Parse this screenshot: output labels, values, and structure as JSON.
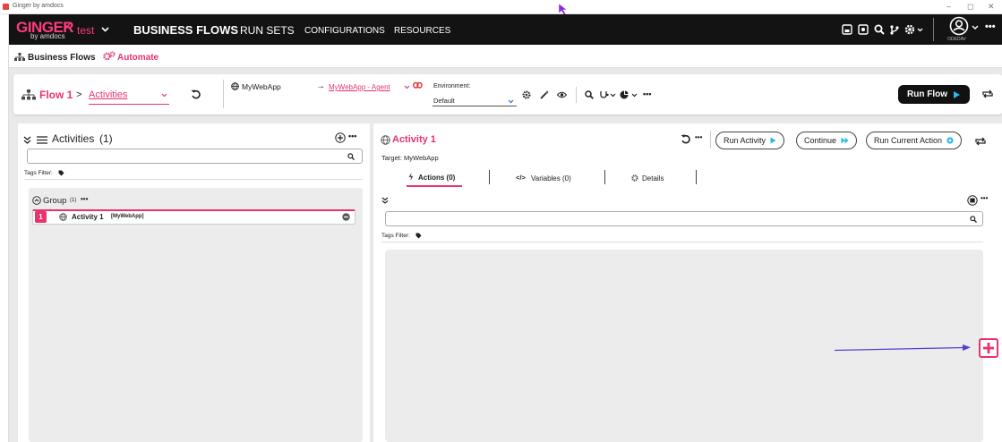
{
  "window": {
    "title": "Ginger by amdocs",
    "minimize": "–",
    "restore": "◻",
    "close": "✕"
  },
  "nav": {
    "logo": "GINGER",
    "logo_sub": "by amdocs",
    "solution": "test",
    "items": [
      "BUSINESS FLOWS",
      "RUN SETS",
      "CONFIGURATIONS",
      "RESOURCES"
    ],
    "user_label": "ODEDAV"
  },
  "breadcrumb": {
    "business_flows": "Business Flows",
    "automate": "Automate"
  },
  "flow": {
    "name": "Flow 1",
    "separator": ">",
    "view": "Activities",
    "target_app": "MyWebApp",
    "agent": "MyWebApp - Agent",
    "env_label": "Environment:",
    "env_value": "Default",
    "run_flow": "Run Flow",
    "more": "•••"
  },
  "activities_panel": {
    "title": "Activities",
    "count": "(1)",
    "tags_filter": "Tags Filter:",
    "group": "Group",
    "group_count": "(1)",
    "activity": {
      "index": "1",
      "name": "Activity 1",
      "target": "[MyWebApp]"
    },
    "more": "•••"
  },
  "activity_panel": {
    "title": "Activity 1",
    "target": "Target: MyWebApp",
    "run_activity": "Run Activity",
    "continue": "Continue",
    "run_current_action": "Run Current Action",
    "tabs": [
      "Actions (0)",
      "Variables (0)",
      "Details"
    ],
    "tags_filter": "Tags Filter:",
    "more": "•••"
  },
  "colors": {
    "accent": "#e8336e",
    "nav_bg": "#131313",
    "play": "#2bb7e8",
    "annotation_arrow": "#5b3bd6"
  }
}
